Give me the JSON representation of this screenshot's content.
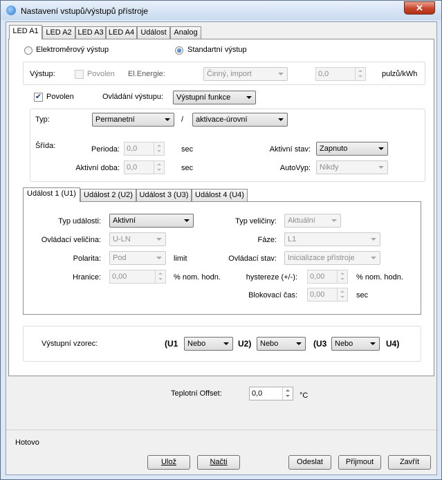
{
  "window": {
    "title": "Nastavení vstupů/výstupů přístroje",
    "close_glyph": "✕"
  },
  "tabs": [
    "LED A1",
    "LED A2",
    "LED A3",
    "LED A4",
    "Událost",
    "Analog"
  ],
  "output_mode": {
    "energy_label": "Elektroměrový výstup",
    "standard_label": "Standartní výstup",
    "selected": "standard"
  },
  "energy_output": {
    "output_label": "Výstup:",
    "enabled_label": "Povolen",
    "energy_label": "El.Energie:",
    "energy_value": "Činný, import",
    "pulse_value": "0,0",
    "unit": "pulzů/kWh"
  },
  "control": {
    "enabled_label": "Povolen",
    "control_label": "Ovládání výstupu:",
    "control_value": "Výstupní funkce"
  },
  "type": {
    "type_label": "Typ:",
    "type_value": "Permanetní",
    "slash": "/",
    "activation_value": "aktivace-úrovní"
  },
  "duty": {
    "label": "Šřída:",
    "period_label": "Perioda:",
    "period_value": "0,0",
    "period_unit": "sec",
    "active_time_label": "Aktivní doba:",
    "active_time_value": "0,0",
    "active_time_unit": "sec",
    "active_state_label": "Aktivní stav:",
    "active_state_value": "Zapnuto",
    "autovyp_label": "AutoVyp:",
    "autovyp_value": "Nikdy"
  },
  "event_tabs": [
    "Událost 1 (U1)",
    "Událost 2 (U2)",
    "Událost 3 (U3)",
    "Událost 4 (U4)"
  ],
  "event": {
    "event_type_label": "Typ události:",
    "event_type_value": "Aktivní",
    "qty_type_label": "Typ veličiny:",
    "qty_type_value": "Aktuální",
    "control_qty_label": "Ovládací veličina:",
    "control_qty_value": "U-LN",
    "phase_label": "Fáze:",
    "phase_value": "L1",
    "polarity_label": "Polarita:",
    "polarity_value": "Pod",
    "limit_label": "limit",
    "control_state_label": "Ovládací stav:",
    "control_state_value": "Inicializace přístroje",
    "threshold_label": "Hranice:",
    "threshold_value": "0,00",
    "threshold_unit": "% nom. hodn.",
    "hysteresis_label": "hystereze (+/-):",
    "hysteresis_value": "0,00",
    "hysteresis_unit": "% nom. hodn.",
    "block_time_label": "Blokovací čas:",
    "block_time_value": "0,00",
    "block_time_unit": "sec"
  },
  "formula": {
    "label": "Výstupní vzorec:",
    "u1": "(U1",
    "u2": "U2)",
    "u3": "(U3",
    "u4": "U4)",
    "op1": "Nebo",
    "op2": "Nebo",
    "op3": "Nebo"
  },
  "temp": {
    "label": "Teplotní Offset:",
    "value": "0,0",
    "unit": "°C"
  },
  "status": "Hotovo",
  "buttons": {
    "save": "Ulož",
    "load": "Načti",
    "send": "Odeslat",
    "receive": "Přijmout",
    "close": "Zavřít"
  }
}
